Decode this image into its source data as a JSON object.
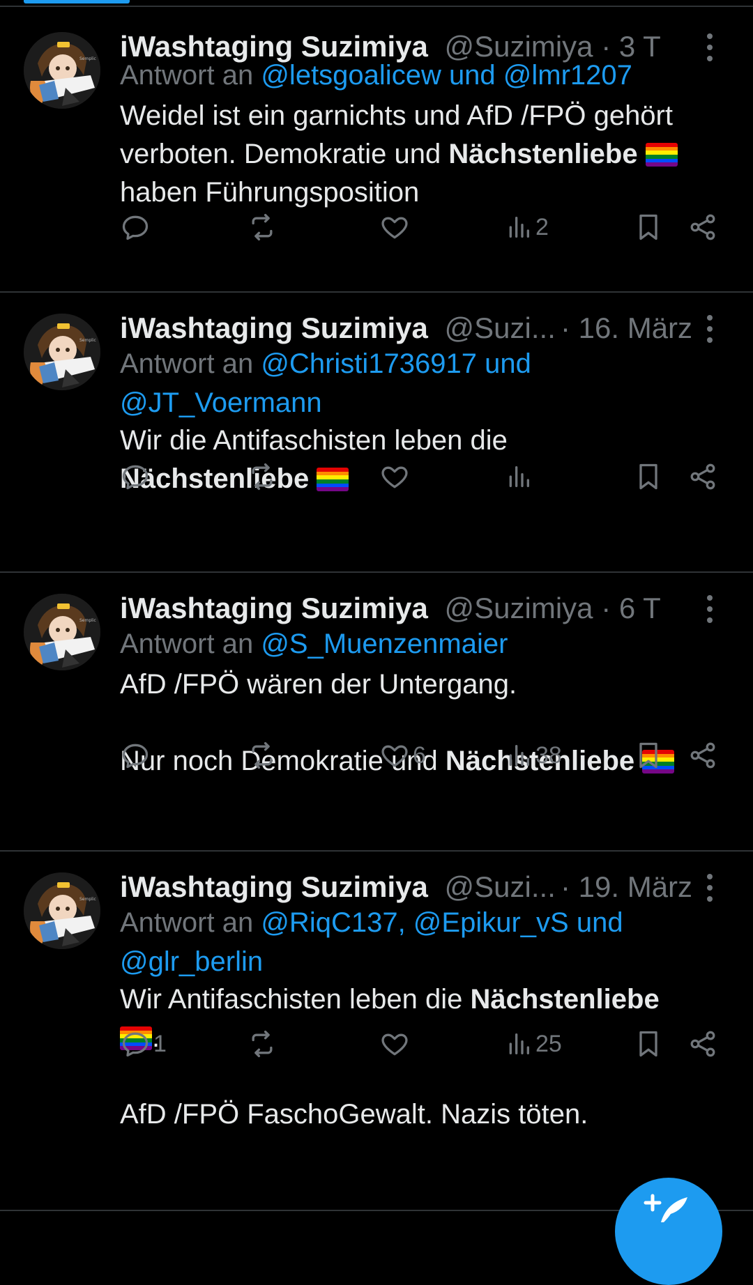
{
  "colors": {
    "background": "#000000",
    "accent": "#1d9bf0",
    "muted": "#71767b",
    "text": "#e7e9ea",
    "divider": "#2f3336"
  },
  "rainbow_flag_colors": [
    "#e40303",
    "#ff8c00",
    "#ffed00",
    "#008026",
    "#004dff",
    "#750787"
  ],
  "icons": [
    "reply-icon",
    "retweet-icon",
    "like-icon",
    "views-icon",
    "bookmark-icon",
    "share-icon",
    "more-icon",
    "compose-icon"
  ],
  "tweets": [
    {
      "name": "iWashtaging Suzimiya",
      "handle": "@Suzimiya",
      "sep": " · ",
      "time": "3 T",
      "reply_prefix": "Antwort an ",
      "reply_line1": "@letsgoalicew und @lmr1207",
      "reply_line2": "",
      "body_1": "Weidel ist ein garnichts und AfD /FPÖ gehört",
      "body_2": "verboten. Demokratie und ",
      "body_2_bold": "Nächstenliebe",
      "body_3": "haben Führungsposition",
      "replies": "",
      "likes": "",
      "views": "2"
    },
    {
      "name": "iWashtaging Suzimiya",
      "handle": "@Suzi...",
      "time": "· 16. März",
      "reply_prefix": "Antwort an ",
      "reply_line1": "@Christi1736917 und",
      "reply_line2": "@JT_Voermann",
      "body_1": "Wir die Antifaschisten leben die",
      "body_2_bold": "Nächstenliebe",
      "replies": "",
      "likes": "",
      "views": ""
    },
    {
      "name": "iWashtaging Suzimiya",
      "handle": "@Suzimiya",
      "sep": " · ",
      "time": "6 T",
      "reply_prefix": "Antwort an ",
      "reply_line1": "@S_Muenzenmaier",
      "body_1": "AfD /FPÖ wären der Untergang.",
      "body_2": "Nur noch Demokratie und ",
      "body_2_bold": "Nächstenliebe",
      "replies": "",
      "likes": "6",
      "views": "38"
    },
    {
      "name": "iWashtaging Suzimiya",
      "handle": "@Suzi...",
      "time": "· 19. März",
      "reply_prefix": "Antwort an ",
      "reply_line1": "@RiqC137, @Epikur_vS und",
      "reply_line2": "@glr_berlin",
      "body_1": "Wir Antifaschisten leben die ",
      "body_1_bold": "Nächstenliebe",
      "body_2_tail": ".",
      "body_3": "AfD /FPÖ FaschoGewalt. Nazis töten.",
      "replies": "1",
      "likes": "",
      "views": "25"
    }
  ]
}
